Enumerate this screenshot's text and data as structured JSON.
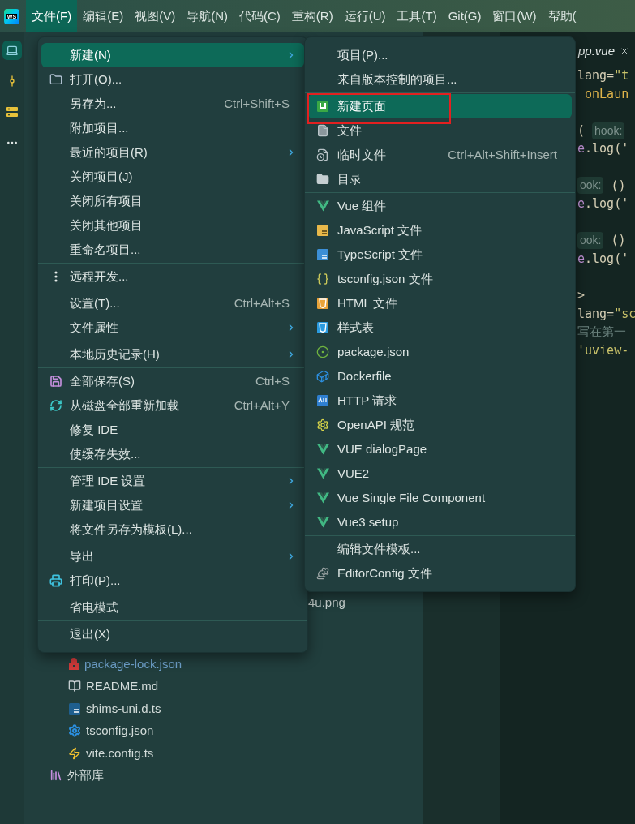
{
  "app_logo": "WS",
  "menu_bar": [
    {
      "label": "文件(F)",
      "selected": true
    },
    {
      "label": "编辑(E)",
      "selected": false
    },
    {
      "label": "视图(V)",
      "selected": false
    },
    {
      "label": "导航(N)",
      "selected": false
    },
    {
      "label": "代码(C)",
      "selected": false
    },
    {
      "label": "重构(R)",
      "selected": false
    },
    {
      "label": "运行(U)",
      "selected": false
    },
    {
      "label": "工具(T)",
      "selected": false
    },
    {
      "label": "Git(G)",
      "selected": false
    },
    {
      "label": "窗口(W)",
      "selected": false
    },
    {
      "label": "帮助(",
      "selected": false
    }
  ],
  "tool_strip": [
    {
      "selected": true
    },
    {
      "selected": false
    },
    {
      "selected": false
    },
    {
      "selected": false
    }
  ],
  "file_menu": {
    "groups": [
      [
        {
          "label": "新建(N)",
          "selected": true,
          "submenu": true
        },
        {
          "label": "打开(O)...",
          "selected": false,
          "submenu": false
        },
        {
          "label": "另存为...",
          "shortcut": "Ctrl+Shift+S",
          "selected": false,
          "submenu": false
        },
        {
          "label": "附加项目...",
          "selected": false,
          "submenu": false
        },
        {
          "label": "最近的项目(R)",
          "selected": false,
          "submenu": true
        },
        {
          "label": "关闭项目(J)",
          "selected": false,
          "submenu": false
        },
        {
          "label": "关闭所有项目",
          "selected": false,
          "submenu": false
        },
        {
          "label": "关闭其他项目",
          "selected": false,
          "submenu": false
        },
        {
          "label": "重命名项目...",
          "selected": false,
          "submenu": false
        }
      ],
      [
        {
          "label": "远程开发...",
          "selected": false,
          "submenu": false
        }
      ],
      [
        {
          "label": "设置(T)...",
          "shortcut": "Ctrl+Alt+S",
          "selected": false,
          "submenu": false
        },
        {
          "label": "文件属性",
          "selected": false,
          "submenu": true
        }
      ],
      [
        {
          "label": "本地历史记录(H)",
          "selected": false,
          "submenu": true
        }
      ],
      [
        {
          "label": "全部保存(S)",
          "shortcut": "Ctrl+S",
          "selected": false,
          "submenu": false
        },
        {
          "label": "从磁盘全部重新加载",
          "shortcut": "Ctrl+Alt+Y",
          "selected": false,
          "submenu": false
        },
        {
          "label": "修复 IDE",
          "selected": false,
          "submenu": false
        },
        {
          "label": "使缓存失效...",
          "selected": false,
          "submenu": false
        }
      ],
      [
        {
          "label": "管理 IDE 设置",
          "selected": false,
          "submenu": true
        },
        {
          "label": "新建项目设置",
          "selected": false,
          "submenu": true
        },
        {
          "label": "将文件另存为模板(L)...",
          "selected": false,
          "submenu": false
        }
      ],
      [
        {
          "label": "导出",
          "selected": false,
          "submenu": true
        },
        {
          "label": "打印(P)...",
          "selected": false,
          "submenu": false
        }
      ],
      [
        {
          "label": "省电模式",
          "selected": false,
          "submenu": false
        }
      ],
      [
        {
          "label": "退出(X)",
          "selected": false,
          "submenu": false
        }
      ]
    ]
  },
  "new_submenu": {
    "groups": [
      [
        {
          "label": "项目(P)...",
          "selected": false,
          "annotated": false
        },
        {
          "label": "来自版本控制的项目...",
          "selected": false,
          "annotated": false
        }
      ],
      [
        {
          "label": "新建页面",
          "selected": true,
          "annotated": true
        },
        {
          "label": "文件",
          "selected": false,
          "annotated": false
        },
        {
          "label": "临时文件",
          "shortcut": "Ctrl+Alt+Shift+Insert",
          "selected": false,
          "annotated": false
        },
        {
          "label": "目录",
          "selected": false,
          "annotated": false
        }
      ],
      [
        {
          "label": "Vue 组件",
          "selected": false,
          "annotated": false
        },
        {
          "label": "JavaScript 文件",
          "selected": false,
          "annotated": false
        },
        {
          "label": "TypeScript 文件",
          "selected": false,
          "annotated": false
        },
        {
          "label": "tsconfig.json 文件",
          "selected": false,
          "annotated": false
        },
        {
          "label": "HTML 文件",
          "selected": false,
          "annotated": false
        },
        {
          "label": "样式表",
          "selected": false,
          "annotated": false
        },
        {
          "label": "package.json",
          "selected": false,
          "annotated": false
        },
        {
          "label": "Dockerfile",
          "selected": false,
          "annotated": false
        },
        {
          "label": "HTTP 请求",
          "selected": false,
          "annotated": false
        },
        {
          "label": "OpenAPI 规范",
          "selected": false,
          "annotated": false
        },
        {
          "label": "VUE dialogPage",
          "selected": false,
          "annotated": false
        },
        {
          "label": "VUE2",
          "selected": false,
          "annotated": false
        },
        {
          "label": "Vue Single File Component",
          "selected": false,
          "annotated": false
        },
        {
          "label": "Vue3 setup",
          "selected": false,
          "annotated": false
        }
      ],
      [
        {
          "label": "编辑文件模板...",
          "selected": false,
          "annotated": false
        },
        {
          "label": "EditorConfig 文件",
          "selected": false,
          "annotated": false
        }
      ]
    ]
  },
  "project_tree": {
    "file_name_tail": "4u.png",
    "files": [
      {
        "label": "package-lock.json",
        "ignored": true
      },
      {
        "label": "README.md",
        "ignored": false
      },
      {
        "label": "shims-uni.d.ts",
        "ignored": false
      },
      {
        "label": "tsconfig.json",
        "ignored": false
      },
      {
        "label": "vite.config.ts",
        "ignored": false
      }
    ],
    "external_libraries": "外部库"
  },
  "editor": {
    "tab": {
      "label": "pp.vue",
      "selected": true
    },
    "code_blocks": [
      [
        [
          {
            "kind": "plain",
            "text": "lang="
          },
          {
            "kind": "string",
            "text": "\"t"
          }
        ],
        [
          {
            "kind": "func",
            "text": " onLaun"
          }
        ]
      ],
      [
        [
          {
            "kind": "plain",
            "text": "( "
          },
          {
            "kind": "hint",
            "text": "hook:"
          }
        ],
        [
          {
            "kind": "keyword",
            "text": "e"
          },
          {
            "kind": "plain",
            "text": ".log('"
          }
        ]
      ],
      [
        [
          {
            "kind": "hint",
            "text": "ook:"
          },
          {
            "kind": "plain",
            "text": " ()"
          }
        ],
        [
          {
            "kind": "keyword",
            "text": "e"
          },
          {
            "kind": "plain",
            "text": ".log('"
          }
        ]
      ],
      [
        [
          {
            "kind": "hint",
            "text": "ook:"
          },
          {
            "kind": "plain",
            "text": " ()"
          }
        ],
        [
          {
            "kind": "keyword",
            "text": "e"
          },
          {
            "kind": "plain",
            "text": ".log('"
          }
        ]
      ],
      [
        [
          {
            "kind": "plain",
            "text": ">"
          }
        ],
        [
          {
            "kind": "plain",
            "text": "lang="
          },
          {
            "kind": "string",
            "text": "\"sc"
          }
        ],
        [
          {
            "kind": "comment",
            "text": "写在第一"
          }
        ],
        [
          {
            "kind": "string",
            "text": "'uview-"
          }
        ]
      ]
    ]
  }
}
